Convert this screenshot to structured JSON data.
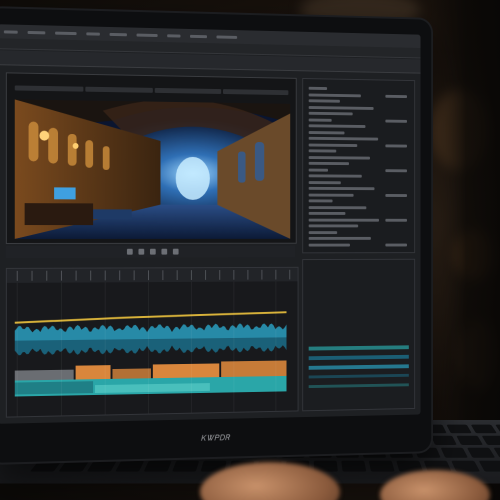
{
  "laptop": {
    "brand_label": "ᏦᏔᏢᎠᏒ"
  },
  "editor": {
    "menu_items": [
      "",
      "",
      "",
      "",
      "",
      "",
      ""
    ],
    "viewer": {
      "scene_description_tag": "hall-render"
    }
  },
  "colors": {
    "waveform": "#2a9fbf",
    "waveform_dark": "#1b6f8a",
    "yellow_line": "#d8b23a",
    "orange_clip": "#d9863c",
    "teal_clip": "#2aa6a8",
    "screen_bg": "#1e2023"
  },
  "icons": [
    "play-icon",
    "pause-icon",
    "rewind-icon",
    "forward-icon",
    "stop-icon"
  ]
}
